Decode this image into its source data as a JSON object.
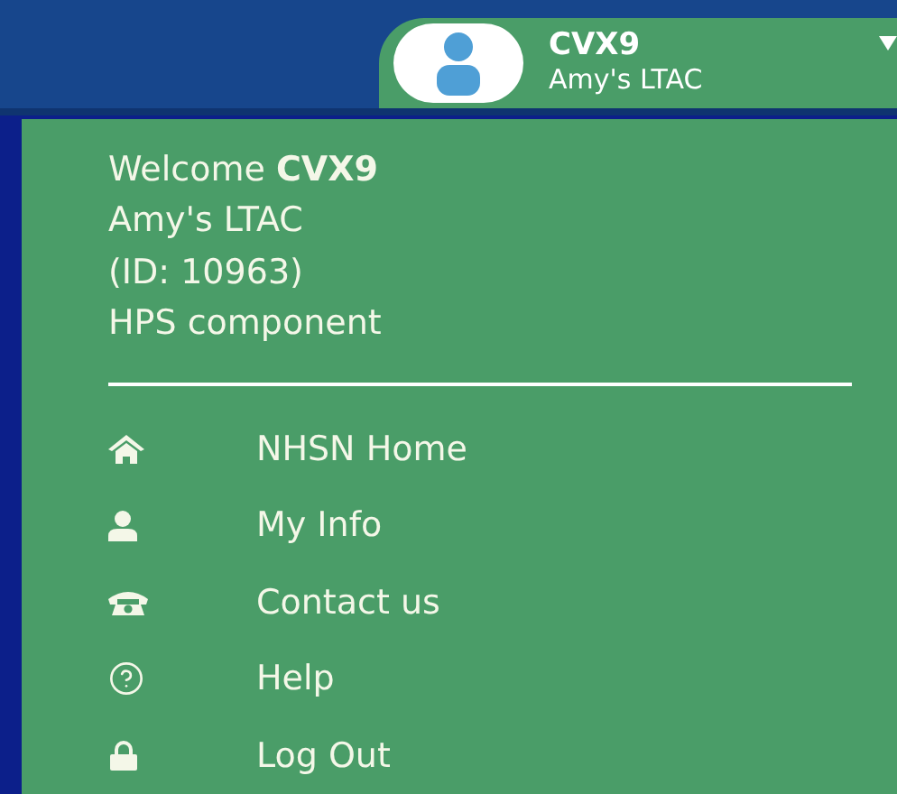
{
  "account": {
    "user": "CVX9",
    "facility": "Amy's LTAC"
  },
  "welcome": {
    "lines": [
      "Welcome **CVX9**",
      "Amy's LTAC",
      "(ID: 10963)",
      "HPS component"
    ]
  },
  "menu": [
    {
      "kind": "home",
      "label": "NHSN Home"
    },
    {
      "kind": "user",
      "label": "My Info"
    },
    {
      "kind": "phone",
      "label": "Contact us"
    },
    {
      "kind": "help",
      "label": "Help"
    },
    {
      "kind": "lock",
      "label": "Log Out"
    }
  ]
}
